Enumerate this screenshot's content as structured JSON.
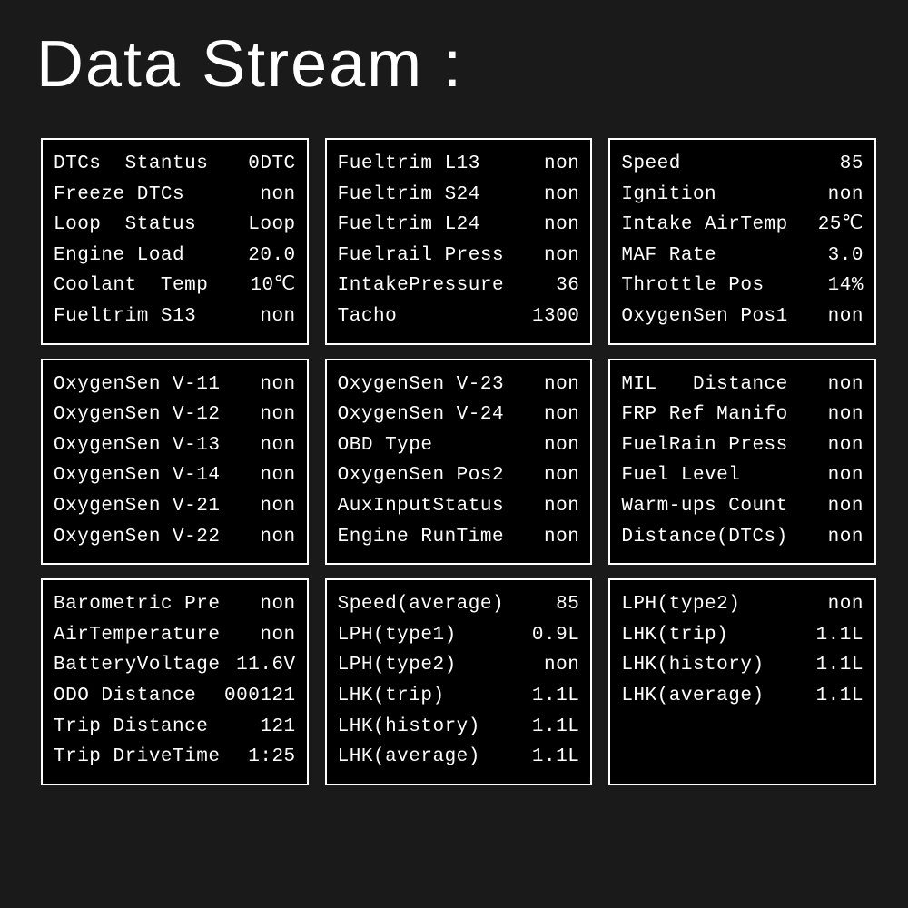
{
  "title": "Data Stream :",
  "panels": [
    [
      {
        "label": "DTCs  Stantus",
        "value": "0DTC"
      },
      {
        "label": "Freeze DTCs",
        "value": "non"
      },
      {
        "label": "Loop  Status",
        "value": "Loop"
      },
      {
        "label": "Engine Load",
        "value": "20.0"
      },
      {
        "label": "Coolant  Temp",
        "value": "10℃"
      },
      {
        "label": "Fueltrim S13",
        "value": "non"
      }
    ],
    [
      {
        "label": "Fueltrim L13",
        "value": "non"
      },
      {
        "label": "Fueltrim S24",
        "value": "non"
      },
      {
        "label": "Fueltrim L24",
        "value": "non"
      },
      {
        "label": "Fuelrail Press",
        "value": "non"
      },
      {
        "label": "IntakePressure",
        "value": "36"
      },
      {
        "label": "Tacho",
        "value": "1300"
      }
    ],
    [
      {
        "label": "Speed",
        "value": "85"
      },
      {
        "label": "Ignition",
        "value": "non"
      },
      {
        "label": "Intake AirTemp",
        "value": "25℃"
      },
      {
        "label": "MAF Rate",
        "value": "3.0"
      },
      {
        "label": "Throttle Pos",
        "value": "14%"
      },
      {
        "label": "OxygenSen Pos1",
        "value": "non"
      }
    ],
    [
      {
        "label": "OxygenSen V-11",
        "value": "non"
      },
      {
        "label": "OxygenSen V-12",
        "value": "non"
      },
      {
        "label": "OxygenSen V-13",
        "value": "non"
      },
      {
        "label": "OxygenSen V-14",
        "value": "non"
      },
      {
        "label": "OxygenSen V-21",
        "value": "non"
      },
      {
        "label": "OxygenSen V-22",
        "value": "non"
      }
    ],
    [
      {
        "label": "OxygenSen V-23",
        "value": "non"
      },
      {
        "label": "OxygenSen V-24",
        "value": "non"
      },
      {
        "label": "OBD Type",
        "value": "non"
      },
      {
        "label": "OxygenSen Pos2",
        "value": "non"
      },
      {
        "label": "AuxInputStatus",
        "value": "non"
      },
      {
        "label": "Engine RunTime",
        "value": "non"
      }
    ],
    [
      {
        "label": "MIL   Distance",
        "value": "non"
      },
      {
        "label": "FRP Ref Manifo",
        "value": "non"
      },
      {
        "label": "FuelRain Press",
        "value": "non"
      },
      {
        "label": "Fuel Level",
        "value": "non"
      },
      {
        "label": "Warm-ups Count",
        "value": "non"
      },
      {
        "label": "Distance(DTCs)",
        "value": "non"
      }
    ],
    [
      {
        "label": "Barometric Pre",
        "value": "non"
      },
      {
        "label": "AirTemperature",
        "value": "non"
      },
      {
        "label": "BatteryVoltage",
        "value": "11.6V"
      },
      {
        "label": "ODO Distance",
        "value": "000121"
      },
      {
        "label": "Trip Distance",
        "value": "121"
      },
      {
        "label": "Trip DriveTime",
        "value": "1:25"
      }
    ],
    [
      {
        "label": "Speed(average)",
        "value": "85"
      },
      {
        "label": "LPH(type1)",
        "value": "0.9L"
      },
      {
        "label": "LPH(type2)",
        "value": "non"
      },
      {
        "label": "LHK(trip)",
        "value": "1.1L"
      },
      {
        "label": "LHK(history)",
        "value": "1.1L"
      },
      {
        "label": "LHK(average)",
        "value": "1.1L"
      }
    ],
    [
      {
        "label": "LPH(type2)",
        "value": "non"
      },
      {
        "label": "LHK(trip)",
        "value": "1.1L"
      },
      {
        "label": "LHK(history)",
        "value": "1.1L"
      },
      {
        "label": "LHK(average)",
        "value": "1.1L"
      }
    ]
  ]
}
